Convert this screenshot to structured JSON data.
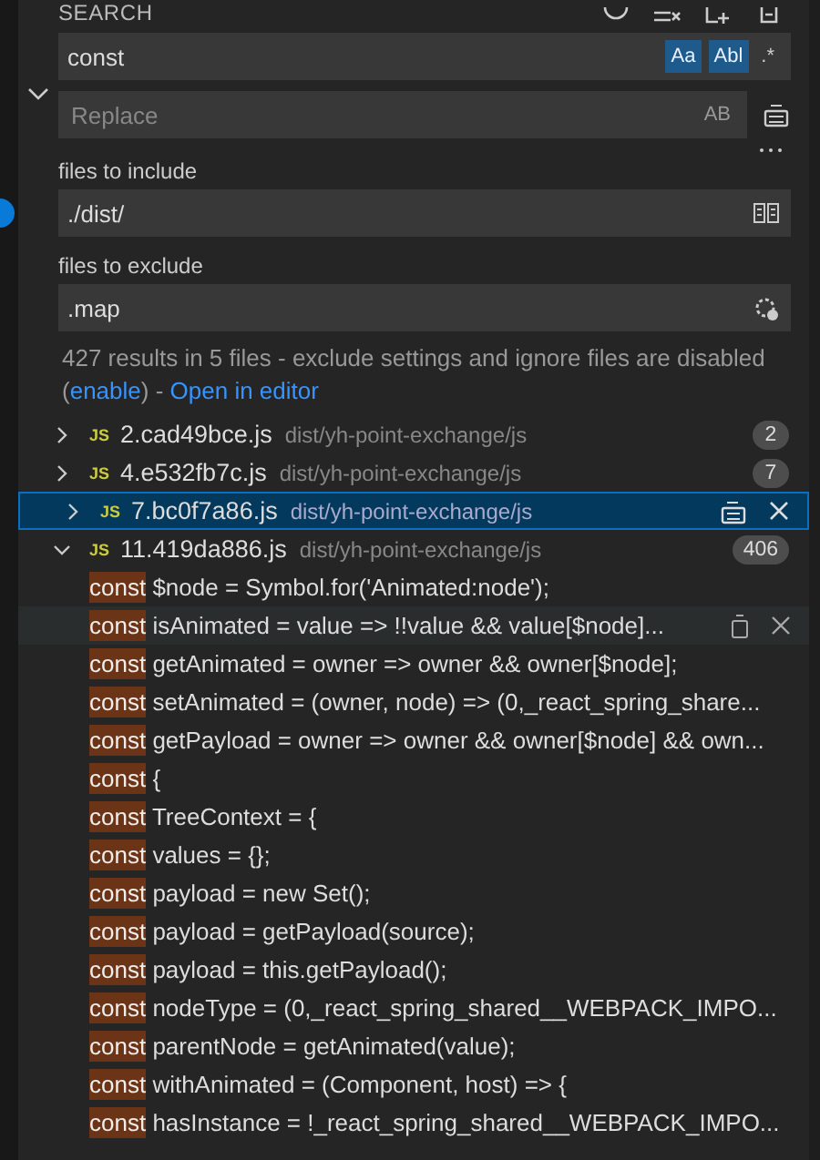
{
  "panel_title": "SEARCH",
  "search": {
    "value": "const",
    "toggles": [
      {
        "label": "Aa",
        "selected": true
      },
      {
        "label": "Abl",
        "selected": true
      },
      {
        "label": ".*",
        "selected": false
      }
    ]
  },
  "replace": {
    "placeholder": "Replace",
    "toggle_label": "AB"
  },
  "include": {
    "label": "files to include",
    "value": "./dist/"
  },
  "exclude": {
    "label": "files to exclude",
    "value": ".map"
  },
  "message": {
    "before": "427 results in 5 files - exclude settings and ignore files are disabled (",
    "link": "enable",
    "middle": ") - ",
    "open_link": "Open in editor"
  },
  "files": [
    {
      "type_label": "JS",
      "name": "2.cad49bce.js",
      "path": "dist/yh-point-exchange/js",
      "count": "2",
      "expanded": false,
      "selected": false
    },
    {
      "type_label": "JS",
      "name": "4.e532fb7c.js",
      "path": "dist/yh-point-exchange/js",
      "count": "7",
      "expanded": false,
      "selected": false
    },
    {
      "type_label": "JS",
      "name": "7.bc0f7a86.js",
      "path": "dist/yh-point-exchange/js",
      "expanded": false,
      "selected": true
    },
    {
      "type_label": "JS",
      "name": "11.419da886.js",
      "path": "dist/yh-point-exchange/js",
      "count": "406",
      "expanded": true,
      "selected": false,
      "results": [
        {
          "match": "const",
          "rest": " $node = Symbol.for('Animated:node');",
          "hovered": false
        },
        {
          "match": "const",
          "rest": " isAnimated = value => !!value && value[$node]...",
          "hovered": true
        },
        {
          "match": "const",
          "rest": " getAnimated = owner => owner && owner[$node];",
          "hovered": false
        },
        {
          "match": "const",
          "rest": " setAnimated = (owner, node) => (0,_react_spring_share...",
          "hovered": false
        },
        {
          "match": "const",
          "rest": " getPayload = owner => owner && owner[$node] && own...",
          "hovered": false
        },
        {
          "match": "const",
          "rest": " {",
          "hovered": false
        },
        {
          "match": "const",
          "rest": " TreeContext = {",
          "hovered": false
        },
        {
          "match": "const",
          "rest": " values = {};",
          "hovered": false
        },
        {
          "match": "const",
          "rest": " payload = new Set();",
          "hovered": false
        },
        {
          "match": "const",
          "rest": " payload = getPayload(source);",
          "hovered": false
        },
        {
          "match": "const",
          "rest": " payload = this.getPayload();",
          "hovered": false
        },
        {
          "match": "const",
          "rest": " nodeType = (0,_react_spring_shared__WEBPACK_IMPO...",
          "hovered": false
        },
        {
          "match": "const",
          "rest": " parentNode = getAnimated(value);",
          "hovered": false
        },
        {
          "match": "const",
          "rest": " withAnimated = (Component, host) => {",
          "hovered": false
        },
        {
          "match": "const",
          "rest": " hasInstance = !_react_spring_shared__WEBPACK_IMPO...",
          "hovered": false
        }
      ]
    }
  ]
}
